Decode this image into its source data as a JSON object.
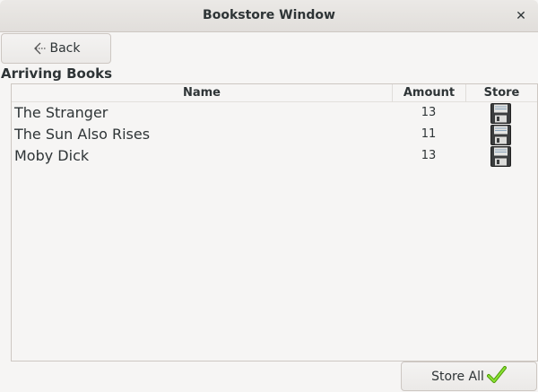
{
  "window": {
    "title": "Bookstore Window",
    "close_icon": "close-icon"
  },
  "toolbar": {
    "back_label": "Back",
    "back_icon": "back-arrow-icon"
  },
  "section": {
    "title": "Arriving Books"
  },
  "table": {
    "columns": {
      "name": "Name",
      "amount": "Amount",
      "store": "Store"
    },
    "rows": [
      {
        "name": "The Stranger",
        "amount": "13",
        "store_icon": "floppy-disk-icon"
      },
      {
        "name": "The Sun Also Rises",
        "amount": "11",
        "store_icon": "floppy-disk-icon"
      },
      {
        "name": "Moby Dick",
        "amount": "13",
        "store_icon": "floppy-disk-icon"
      }
    ]
  },
  "footer": {
    "store_all_label": "Store All",
    "store_all_icon": "checkmark-icon",
    "checkmark_color": "#73d216"
  }
}
